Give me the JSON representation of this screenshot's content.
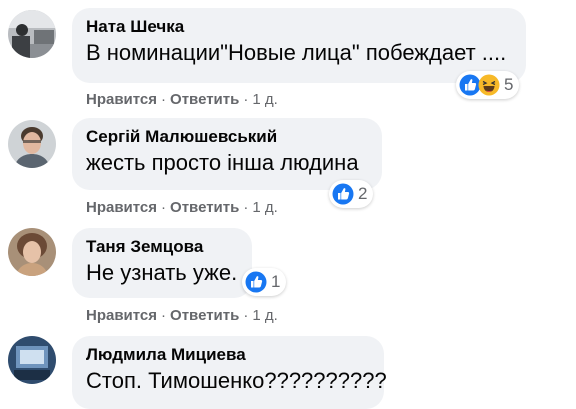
{
  "colors": {
    "bubble_bg": "#f0f2f5",
    "like_blue": "#1877f2",
    "haha_yellow": "#f7b928",
    "meta_gray": "#65676b"
  },
  "comments": [
    {
      "author": "Ната Шечка",
      "text": "В номинации\"Новые лица\" побеждает ....",
      "reactions": [
        "like-icon",
        "haha-icon"
      ],
      "reaction_count": "5",
      "like_label": "Нравится",
      "reply_label": "Ответить",
      "separator": "·",
      "time": "1 д."
    },
    {
      "author": "Сергій Малюшевський",
      "text": "жесть просто інша людина",
      "reactions": [
        "like-icon"
      ],
      "reaction_count": "2",
      "like_label": "Нравится",
      "reply_label": "Ответить",
      "separator": "·",
      "time": "1 д."
    },
    {
      "author": "Таня Земцова",
      "text": "Не узнать уже.",
      "reactions": [
        "like-icon"
      ],
      "reaction_count": "1",
      "like_label": "Нравится",
      "reply_label": "Ответить",
      "separator": "·",
      "time": "1 д."
    },
    {
      "author": "Людмила Мициева",
      "text": "Стоп. Тимошенко??????????",
      "reactions": [],
      "like_label": "",
      "reply_label": "",
      "separator": "",
      "time": ""
    }
  ]
}
